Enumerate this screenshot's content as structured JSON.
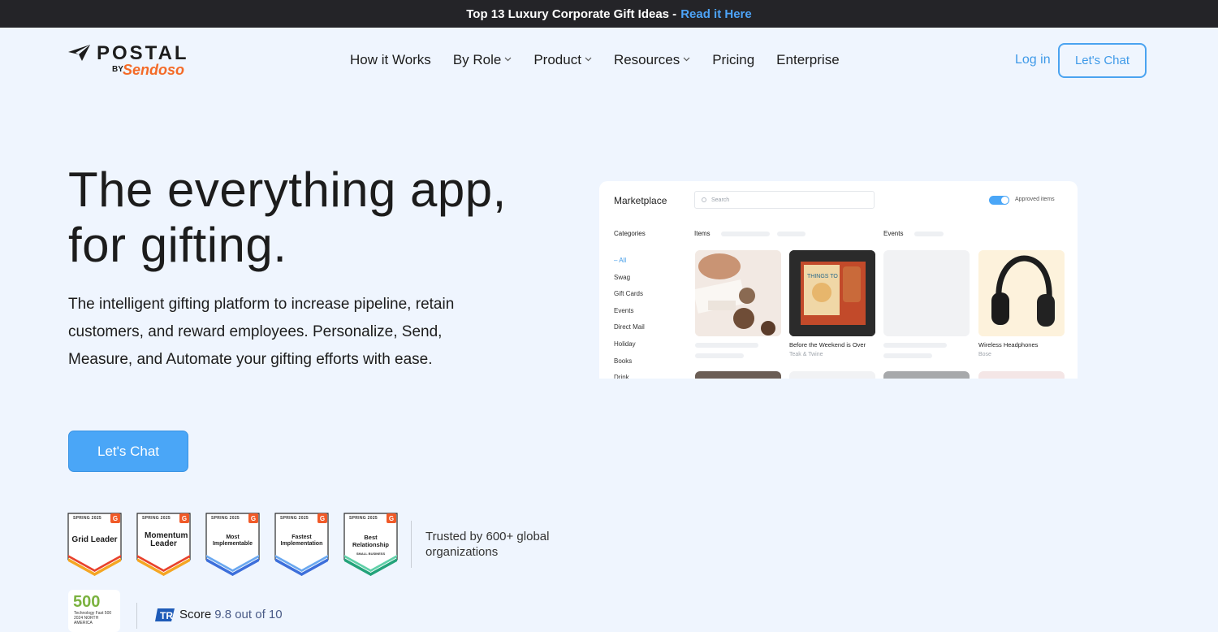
{
  "banner": {
    "text": "Top 13 Luxury Corporate Gift Ideas -",
    "link": "Read it Here"
  },
  "logo": {
    "wordmark": "POSTAL",
    "by": "BY",
    "parent": "Sendoso"
  },
  "nav": {
    "items": [
      {
        "label": "How it Works",
        "dropdown": false
      },
      {
        "label": "By Role",
        "dropdown": true
      },
      {
        "label": "Product",
        "dropdown": true
      },
      {
        "label": "Resources",
        "dropdown": true
      },
      {
        "label": "Pricing",
        "dropdown": false
      },
      {
        "label": "Enterprise",
        "dropdown": false
      }
    ],
    "login": "Log in",
    "cta": "Let's Chat"
  },
  "hero": {
    "title_line1": "The everything app,",
    "title_line2": "for gifting.",
    "subtitle": "The intelligent gifting platform to increase pipeline, retain customers, and reward employees. Personalize, Send, Measure, and Automate your gifting efforts with ease.",
    "cta": "Let's Chat"
  },
  "badges": [
    {
      "season": "SPRING 2025",
      "name": "Grid Leader",
      "extra": "",
      "color": "#f5a623"
    },
    {
      "season": "SPRING 2025",
      "name": "Momentum Leader",
      "extra": "",
      "color": "#f5a623"
    },
    {
      "season": "SPRING 2025",
      "name": "Most Implementable",
      "extra": "",
      "color": "#3d6fdb"
    },
    {
      "season": "SPRING 2025",
      "name": "Fastest Implementation",
      "extra": "",
      "color": "#3d6fdb"
    },
    {
      "season": "SPRING 2025",
      "name": "Best Relationship",
      "extra": "SMALL BUSINESS",
      "color": "#23a37a"
    }
  ],
  "trusted": "Trusted by 600+ global organizations",
  "award": {
    "number": "500",
    "line1": "Technology Fast 500",
    "line2": "2024 NORTH AMERICA"
  },
  "score": {
    "label": "Score",
    "value": "9.8 out of 10"
  },
  "marketplace": {
    "title": "Marketplace",
    "search_placeholder": "Search",
    "toggle_label": "Approved items",
    "categories_heading": "Categories",
    "categories": [
      "– All",
      "Swag",
      "Gift Cards",
      "Events",
      "Direct Mail",
      "Holiday",
      "Books",
      "Drink"
    ],
    "items_heading": "Items",
    "events_heading": "Events",
    "cards": [
      {
        "title": "",
        "subtitle": ""
      },
      {
        "title": "Before the Weekend is Over",
        "subtitle": "Teak & Twine"
      },
      {
        "title": "",
        "subtitle": ""
      },
      {
        "title": "Wireless Headphones",
        "subtitle": "Bose"
      }
    ]
  },
  "colors": {
    "background": "#eff5fe",
    "accent": "#4aa6f7",
    "brand_orange": "#f46a27",
    "banner_bg": "#242428"
  }
}
